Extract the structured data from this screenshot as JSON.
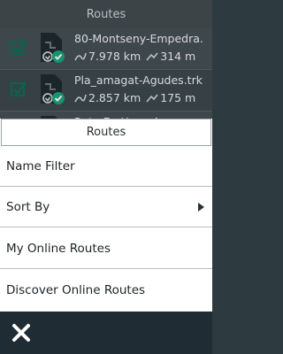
{
  "header": {
    "title": "Routes"
  },
  "routes": [
    {
      "name": "80-Montseny-Empedra.",
      "distance": "7.978 km",
      "elevation": "314 m"
    },
    {
      "name": "Pla_amagat-Agudes.trk",
      "distance": "2.857 km",
      "elevation": "175 m"
    },
    {
      "name": "Ruta En Haya  A...",
      "distance": "",
      "elevation": ""
    }
  ],
  "menu": {
    "title": "Routes",
    "items": [
      {
        "label": "Name Filter"
      },
      {
        "label": "Sort By"
      },
      {
        "label": "My Online Routes"
      },
      {
        "label": "Discover Online Routes"
      }
    ]
  },
  "icons": {
    "checkbox": "checkbox-checked-icon",
    "file": "route-file-icon",
    "distance": "distance-icon",
    "elevation": "elevation-icon",
    "close": "close-icon",
    "submenu": "chevron-right-icon"
  },
  "colors": {
    "accent": "#1aa37a",
    "footer": "#1f2c33"
  }
}
